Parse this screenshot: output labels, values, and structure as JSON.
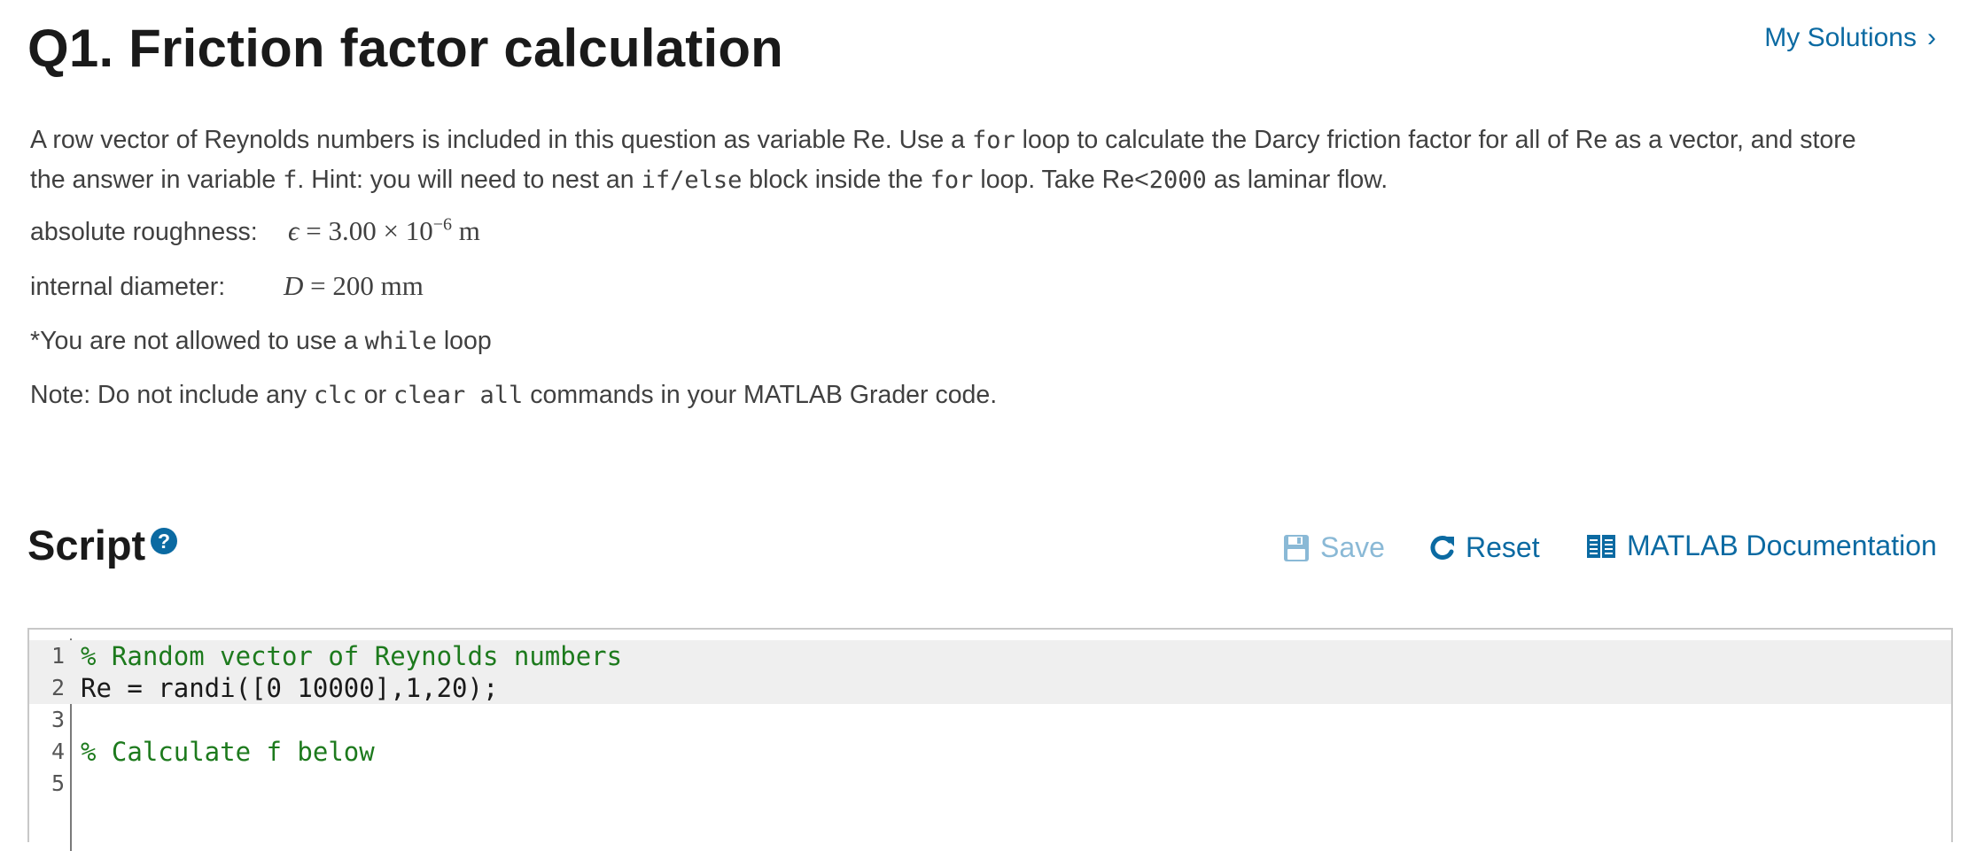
{
  "header": {
    "title": "Q1. Friction factor calculation",
    "my_solutions": "My Solutions",
    "chevron": "›"
  },
  "description": {
    "p1_a": "A row vector of Reynolds numbers is included in this question as variable Re. Use a ",
    "p1_code1": "for",
    "p1_b": " loop to calculate the Darcy friction factor for all of Re as a vector, and store",
    "p1_c": "the answer in variable ",
    "p1_code2": "f",
    "p1_d": ". Hint: you will need to nest an ",
    "p1_code3": "if/else",
    "p1_e": " block inside the ",
    "p1_code4": "for",
    "p1_f": " loop. Take Re<",
    "p1_code5": "2000",
    "p1_g": " as laminar flow.",
    "roughness_label": "absolute roughness:",
    "roughness_symbol": "ϵ",
    "roughness_eq": " = 3.00 × 10",
    "roughness_exp": "−6",
    "roughness_unit": " m",
    "diameter_label": "internal diameter:",
    "diameter_symbol": "D",
    "diameter_eq": " = 200 mm",
    "while_a": "*You are not allowed to use a ",
    "while_code": "while",
    "while_b": " loop",
    "note_a": "Note: Do not include any ",
    "note_code1": "clc",
    "note_b": " or ",
    "note_code2": "clear all",
    "note_c": " commands in your MATLAB Grader code."
  },
  "script": {
    "title": "Script",
    "help_glyph": "?",
    "save_label": "Save",
    "reset_label": "Reset",
    "docs_label": "MATLAB Documentation"
  },
  "editor": {
    "lines": [
      {
        "num": "1",
        "text": "% Random vector of Reynolds numbers"
      },
      {
        "num": "2",
        "text": "Re = randi([0 10000],1,20);"
      },
      {
        "num": "3",
        "text": ""
      },
      {
        "num": "4",
        "text": "% Calculate f below"
      },
      {
        "num": "5",
        "text": ""
      }
    ]
  },
  "colors": {
    "accent": "#0b6aa2",
    "save_disabled": "#8ab9d6",
    "comment": "#1d7a1d"
  },
  "icons": [
    "help-icon",
    "chevron-right-icon",
    "save-disk-icon",
    "refresh-icon",
    "book-icon"
  ]
}
